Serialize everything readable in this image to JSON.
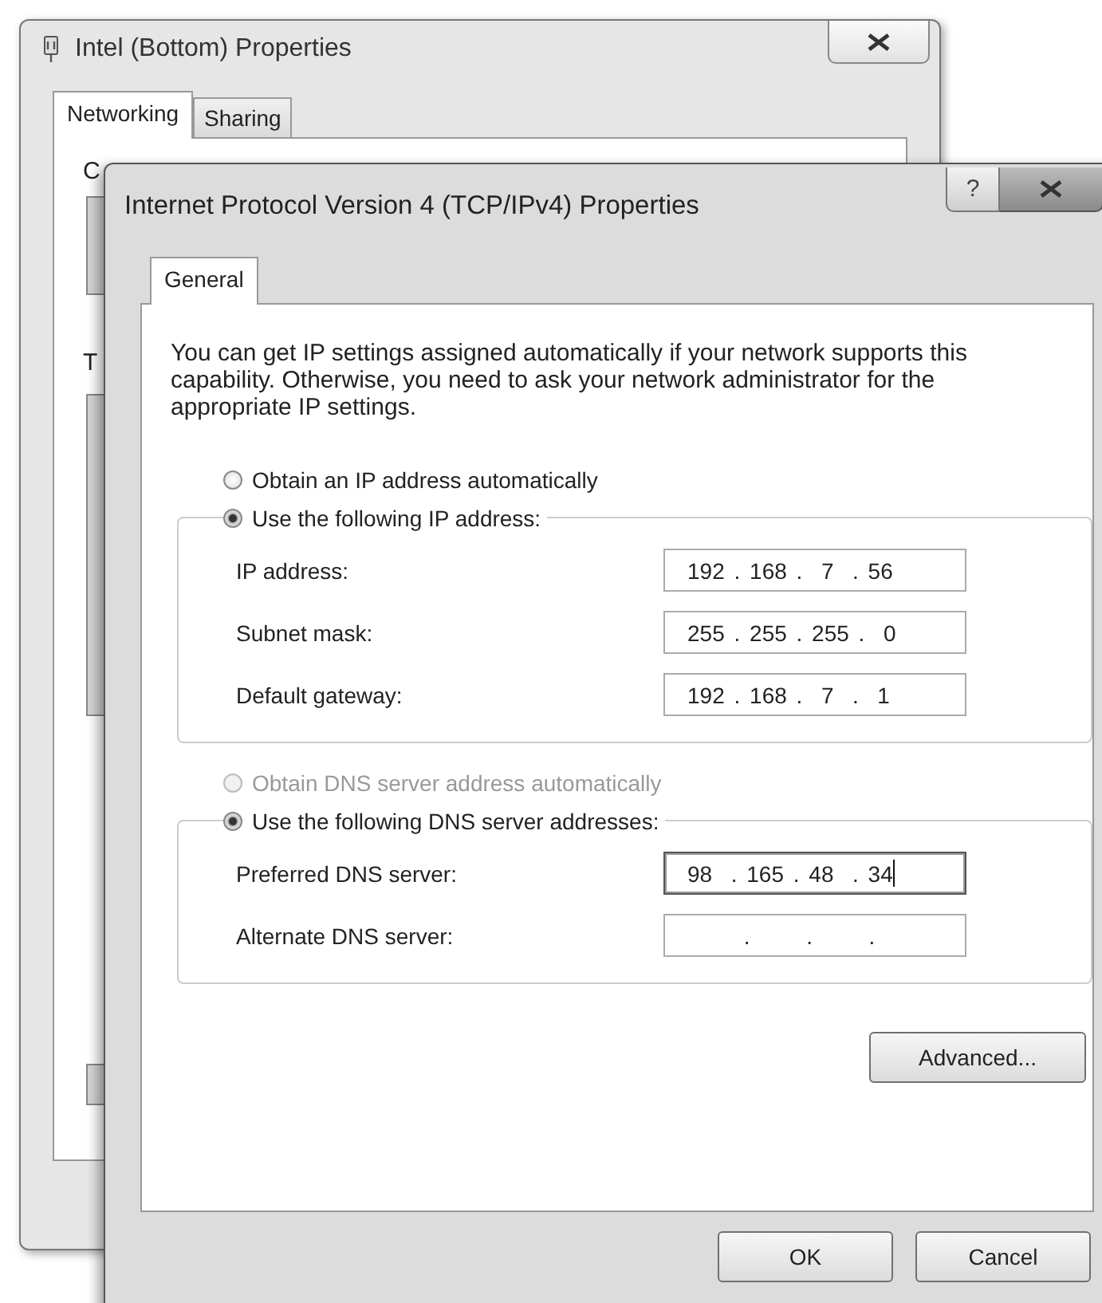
{
  "back_window": {
    "title": "Intel (Bottom) Properties",
    "tabs": [
      {
        "label": "Networking",
        "selected": true
      },
      {
        "label": "Sharing",
        "selected": false
      }
    ],
    "hidden_labels": [
      "C",
      "T"
    ]
  },
  "dialog": {
    "title": "Internet Protocol Version 4 (TCP/IPv4) Properties",
    "help_button": "?",
    "tabs": [
      {
        "label": "General",
        "selected": true
      }
    ],
    "description": "You can get IP settings assigned automatically if your network supports this capability. Otherwise, you need to ask your network administrator for the appropriate IP settings.",
    "ip_options": [
      {
        "label": "Obtain an IP address automatically",
        "selected": false,
        "disabled": false
      },
      {
        "label": "Use the following IP address:",
        "selected": true,
        "disabled": false,
        "fields": [
          {
            "label": "IP address:",
            "value": "192 . 168 .  7  . 56",
            "focused": false
          },
          {
            "label": "Subnet mask:",
            "value": "255 . 255 . 255 .  0",
            "focused": false
          },
          {
            "label": "Default gateway:",
            "value": "192 . 168 .  7  .  1",
            "focused": false
          }
        ]
      }
    ],
    "dns_options": [
      {
        "label": "Obtain DNS server address automatically",
        "selected": false,
        "disabled": true
      },
      {
        "label": "Use the following DNS server addresses:",
        "selected": true,
        "disabled": false,
        "fields": [
          {
            "label": "Preferred DNS server:",
            "value": "98  . 165 . 48  . 34",
            "focused": true
          },
          {
            "label": "Alternate DNS server:",
            "value": "      .      .      .",
            "focused": false
          }
        ]
      }
    ],
    "advanced_button": "Advanced...",
    "buttons": [
      "OK",
      "Cancel"
    ]
  }
}
